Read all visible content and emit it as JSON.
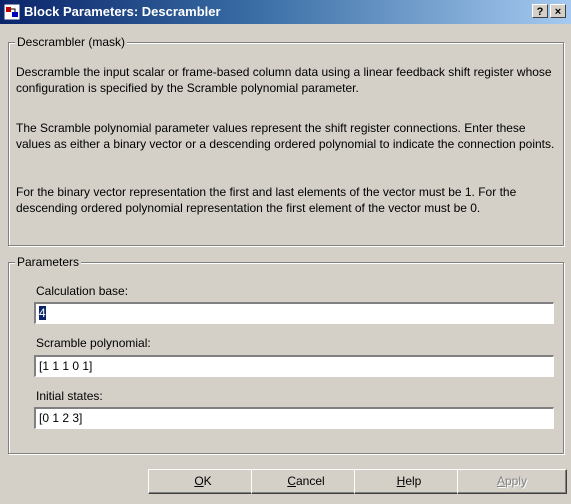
{
  "window": {
    "title": "Block Parameters: Descrambler",
    "help_label": "?",
    "close_label": "×"
  },
  "description_group": {
    "label": "Descrambler (mask)",
    "paragraphs": [
      "Descramble the input scalar or frame-based column data using a linear feedback shift register whose configuration is specified by the Scramble polynomial parameter.",
      "The Scramble polynomial parameter values represent the shift register connections. Enter these values as either a binary vector or a descending ordered polynomial to indicate the connection points.",
      "For the binary vector representation the first and last elements of the vector must be 1. For the descending ordered polynomial representation the first element of the vector must be 0."
    ]
  },
  "parameters_group": {
    "label": "Parameters",
    "fields": [
      {
        "label": "Calculation base:",
        "value": "4"
      },
      {
        "label": "Scramble polynomial:",
        "value": "[1 1 1 0 1]"
      },
      {
        "label": "Initial states:",
        "value": "[0 1 2 3]"
      }
    ]
  },
  "buttons": {
    "ok": {
      "accel": "O",
      "rest": "K"
    },
    "cancel": {
      "accel": "C",
      "rest": "ancel"
    },
    "help": {
      "accel": "H",
      "rest": "elp"
    },
    "apply": {
      "accel": "A",
      "rest": "pply",
      "enabled": false
    }
  },
  "colors": {
    "title_bar_start": "#0a246a",
    "title_bar_end": "#a6caf0",
    "dialog_face": "#d4d0c8",
    "selection": "#0a246a"
  }
}
